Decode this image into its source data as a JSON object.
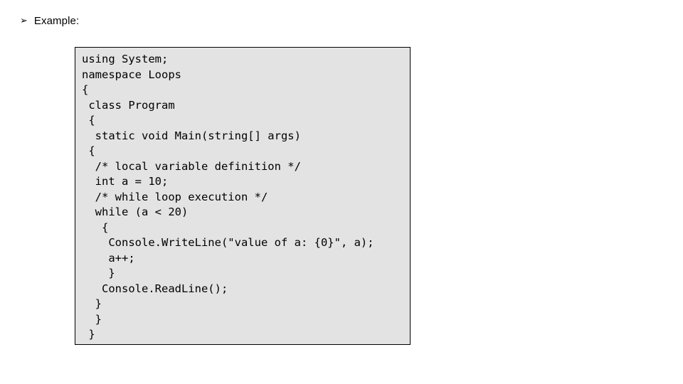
{
  "slide": {
    "background_color": "#FFFFFF",
    "heading": {
      "bullet_glyph": "➢",
      "bullet_icon_name": "arrowhead-bullet-icon",
      "label": "Example:"
    }
  },
  "code_box": {
    "background_color": "#E3E3E3",
    "border_color": "#000000",
    "language": "C#",
    "lines": [
      "using System;",
      "namespace Loops",
      "{",
      " class Program",
      " {",
      "  static void Main(string[] args)",
      " {",
      "  /* local variable definition */",
      "  int a = 10;",
      "  /* while loop execution */",
      "  while (a < 20)",
      "   {",
      "    Console.WriteLine(\"value of a: {0}\", a);",
      "    a++;",
      "    }",
      "   Console.ReadLine();",
      "  }",
      "  }",
      " }"
    ]
  }
}
